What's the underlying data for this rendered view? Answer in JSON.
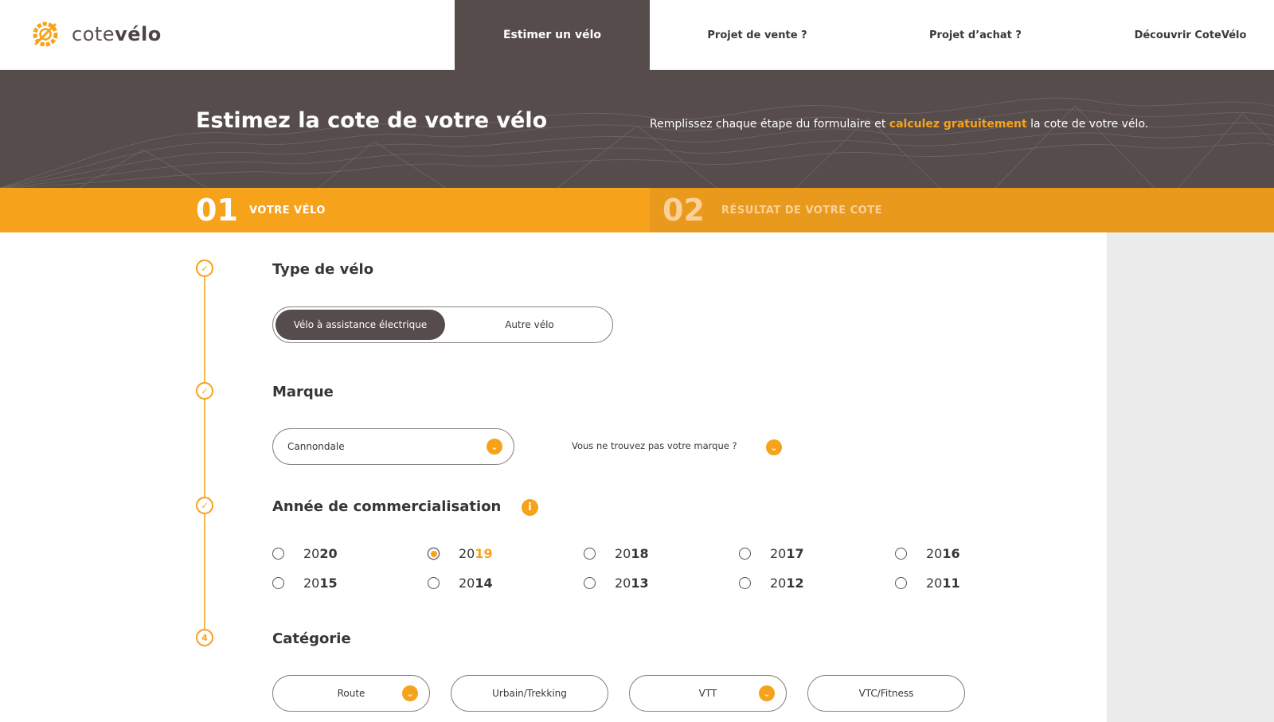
{
  "brand": {
    "name_light": "cote",
    "name_bold": "vélo",
    "color": "#f7a21b"
  },
  "nav": {
    "items": [
      {
        "label": "Estimer un vélo",
        "active": true
      },
      {
        "label": "Projet de vente ?"
      },
      {
        "label": "Projet d’achat ?"
      },
      {
        "label": "Découvrir CoteVélo"
      }
    ]
  },
  "hero": {
    "title": "Estimez la cote de votre vélo",
    "subtitle_before": "Remplissez chaque étape du formulaire et ",
    "subtitle_highlight": "calculez gratuitement",
    "subtitle_after": " la cote de votre vélo."
  },
  "steps": [
    {
      "number": "01",
      "label": "VOTRE VÉLO",
      "active": true
    },
    {
      "number": "02",
      "label": "RÉSULTAT DE VOTRE COTE",
      "active": false
    }
  ],
  "form": {
    "type": {
      "title": "Type de vélo",
      "options": [
        "Vélo à assistance électrique",
        "Autre vélo"
      ],
      "selected": "Vélo à assistance électrique"
    },
    "brand": {
      "title": "Marque",
      "value": "Cannondale",
      "help": "Vous ne trouvez pas votre marque ?"
    },
    "year": {
      "title": "Année de commercialisation",
      "info_icon": "i",
      "options": [
        {
          "lo": "20",
          "hi": "20"
        },
        {
          "lo": "20",
          "hi": "19"
        },
        {
          "lo": "20",
          "hi": "18"
        },
        {
          "lo": "20",
          "hi": "17"
        },
        {
          "lo": "20",
          "hi": "16"
        },
        {
          "lo": "20",
          "hi": "15"
        },
        {
          "lo": "20",
          "hi": "14"
        },
        {
          "lo": "20",
          "hi": "13"
        },
        {
          "lo": "20",
          "hi": "12"
        },
        {
          "lo": "20",
          "hi": "11"
        }
      ],
      "selected": "2019"
    },
    "category": {
      "step_number": "4",
      "title": "Catégorie",
      "options": [
        "Route",
        "Urbain/Trekking",
        "VTT",
        "VTC/Fitness"
      ]
    }
  }
}
